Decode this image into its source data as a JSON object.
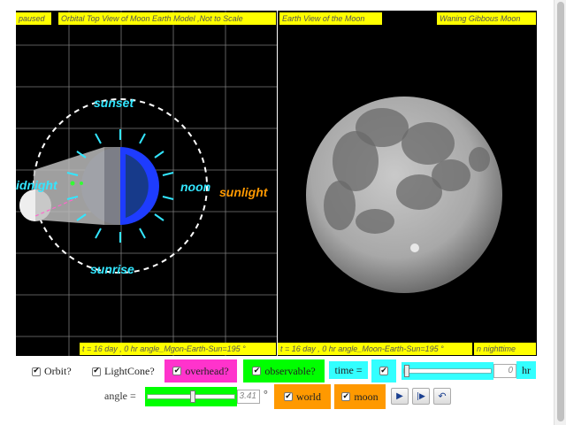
{
  "left_panel": {
    "status": "paused",
    "title": "Orbital Top View of Moon Earth Model ,Not to Scale",
    "bottom_readout": "t = 16 day , 0 hr angle_Mgon-Earth-Sun=195 °",
    "labels": {
      "sunset": "sunset",
      "sunrise": "sunrise",
      "midnight": "idnight",
      "noon": "noon",
      "sunlight": "sunlight"
    },
    "colors": {
      "label_cyan": "#33e6ff",
      "sunlight_orange": "#ff9900",
      "earth_blue": "#1e3cff"
    }
  },
  "right_panel": {
    "title": "Earth View of the Moon",
    "phase": "Waning Gibbous Moon",
    "bottom_readout": "t = 16 day , 0 hr angle_Moon-Earth-Sun=195 °",
    "bottom_status": "n nighttime"
  },
  "controls": {
    "orbit": {
      "label": "Orbit?",
      "checked": true
    },
    "lightcone": {
      "label": "LightCone?",
      "checked": true
    },
    "overhead": {
      "label": "overhead?",
      "checked": true,
      "color": "#ff33cc"
    },
    "observable": {
      "label": "observable?",
      "checked": true,
      "color": "#00ff00"
    },
    "time": {
      "label": "time =",
      "checked": true,
      "value": "0",
      "unit": "hr",
      "color": "#33ffff"
    },
    "angle": {
      "label": "angle =",
      "value": "3.41",
      "unit": "°",
      "color": "#00ff00",
      "slider_fraction": 0.52
    },
    "world": {
      "label": "world",
      "checked": true,
      "color": "#ff9900"
    },
    "moon": {
      "label": "moon",
      "checked": true,
      "color": "#ff9900"
    },
    "buttons": {
      "play_icon": "play-icon",
      "step_icon": "step-forward-icon",
      "reset_icon": "reset-icon"
    }
  }
}
